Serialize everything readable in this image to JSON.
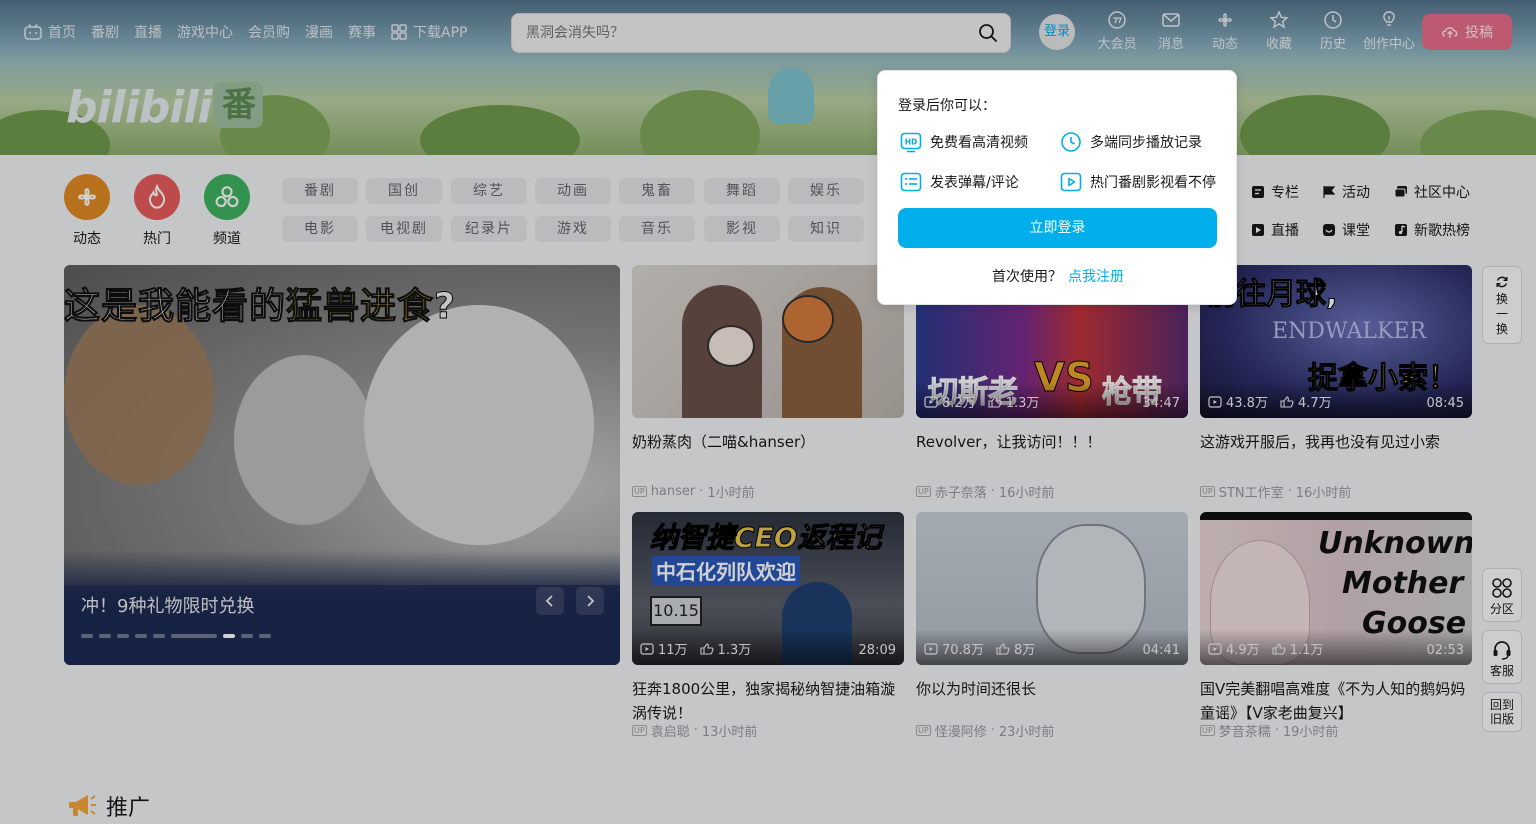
{
  "nav": {
    "items": [
      {
        "label": "首页",
        "icon": "bilibili-tv-icon"
      },
      {
        "label": "番剧"
      },
      {
        "label": "直播"
      },
      {
        "label": "游戏中心"
      },
      {
        "label": "会员购"
      },
      {
        "label": "漫画"
      },
      {
        "label": "赛事"
      },
      {
        "label": "下载APP",
        "icon": "app-grid-icon"
      }
    ]
  },
  "search": {
    "placeholder": "黑洞会消失吗？"
  },
  "header_right": {
    "login": "登录",
    "items": [
      {
        "label": "大会员",
        "icon": "vip-icon"
      },
      {
        "label": "消息",
        "icon": "mail-icon"
      },
      {
        "label": "动态",
        "icon": "fan-icon"
      },
      {
        "label": "收藏",
        "icon": "star-icon"
      },
      {
        "label": "历史",
        "icon": "clock-icon"
      },
      {
        "label": "创作中心",
        "icon": "bulb-icon"
      }
    ],
    "upload": "投稿"
  },
  "banner": {
    "logo_text": "bilibili",
    "logo_badge": "番"
  },
  "quick": [
    {
      "label": "动态",
      "color": "#e08a23",
      "icon": "fan-icon"
    },
    {
      "label": "热门",
      "color": "#e85c5c",
      "icon": "fire-icon"
    },
    {
      "label": "频道",
      "color": "#3fb35f",
      "icon": "channel-icon"
    }
  ],
  "channels": {
    "row1": [
      "番剧",
      "国创",
      "综艺",
      "动画",
      "鬼畜",
      "舞蹈",
      "娱乐"
    ],
    "row2": [
      "电影",
      "电视剧",
      "纪录片",
      "游戏",
      "音乐",
      "影视",
      "知识"
    ],
    "right_row1": [
      {
        "label": "专栏",
        "icon": "column-icon"
      },
      {
        "label": "活动",
        "icon": "flag-icon"
      },
      {
        "label": "社区中心",
        "icon": "community-icon"
      }
    ],
    "right_row2": [
      {
        "label": "直播",
        "icon": "live-icon"
      },
      {
        "label": "课堂",
        "icon": "class-icon"
      },
      {
        "label": "新歌热榜",
        "icon": "music-icon"
      }
    ]
  },
  "carousel": {
    "headline_pre": "这是我能看的",
    "headline_hl": "猛兽进食",
    "headline_post": "?",
    "title": "冲！9种礼物限时兑换",
    "dots": 9,
    "active_dot": 6
  },
  "videos": [
    {
      "title": "奶粉蒸肉（二喵&hanser）",
      "author": "hanser",
      "time": "1小时前",
      "views": "",
      "likes": "",
      "duration": ""
    },
    {
      "title": "Revolver，让我访问！！！",
      "author": "赤子奈落",
      "time": "16小时前",
      "views": "8.2万",
      "likes": "1.3万",
      "duration": "34:47",
      "thumb_text_left": "切斯老",
      "thumb_text_mid": "VS",
      "thumb_text_right": "枪带"
    },
    {
      "title": "这游戏开服后，我再也没有见过小索",
      "author": "STN工作室",
      "time": "16小时前",
      "views": "43.8万",
      "likes": "4.7万",
      "duration": "08:45",
      "thumb_text_top": "前往月球,",
      "thumb_text_mid": "ENDWALKER",
      "thumb_text_bottom": "捉拿小索！"
    },
    {
      "title": "狂奔1800公里，独家揭秘纳智捷油箱漩涡传说！",
      "author": "袁启聪",
      "time": "13小时前",
      "views": "11万",
      "likes": "1.3万",
      "duration": "28:09",
      "thumb_text_top": "纳智捷CEO返程记",
      "thumb_text_sub": "中石化列队欢迎",
      "thumb_text_meter": "10.15"
    },
    {
      "title": "你以为时间还很长",
      "author": "怪漫阿修",
      "time": "23小时前",
      "views": "70.8万",
      "likes": "8万",
      "duration": "04:41"
    },
    {
      "title": "国V完美翻唱高难度《不为人知的鹅妈妈童谣》【V家老曲复兴】",
      "author": "梦音茶糯",
      "time": "19小时前",
      "views": "4.9万",
      "likes": "1.1万",
      "duration": "02:53",
      "thumb_text_1": "Unknown",
      "thumb_text_2": "Mother",
      "thumb_text_3": "Goose"
    }
  ],
  "side": {
    "refresh": "换一换",
    "section": "分区",
    "service": "客服",
    "old_version": "回到旧版"
  },
  "promo": {
    "title": "推广"
  },
  "popup": {
    "title": "登录后你可以：",
    "features": [
      {
        "label": "免费看高清视频",
        "icon": "hd-icon"
      },
      {
        "label": "多端同步播放记录",
        "icon": "clock-icon"
      },
      {
        "label": "发表弹幕/评论",
        "icon": "danmaku-icon"
      },
      {
        "label": "热门番剧影视看不停",
        "icon": "play-icon"
      }
    ],
    "login_button": "立即登录",
    "first_use": "首次使用？",
    "register": "点我注册"
  },
  "colors": {
    "accent": "#00aeec",
    "upload": "#fb7299"
  }
}
